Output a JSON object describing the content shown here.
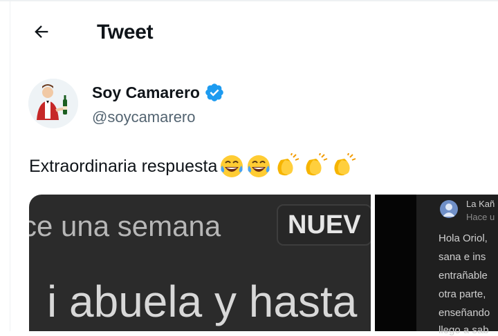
{
  "header": {
    "title": "Tweet",
    "back_icon": "arrow-left-icon"
  },
  "author": {
    "name": "Soy Camarero",
    "handle": "@soycamarero",
    "avatar_icon": "waiter-avatar",
    "verified_icon": "verified-badge-icon",
    "verified_color": "#1d9bf0"
  },
  "tweet": {
    "text": "Extraordinaria respuesta",
    "emojis": [
      "laughing-crying-emoji",
      "laughing-crying-emoji",
      "clapping-hands-emoji",
      "clapping-hands-emoji",
      "clapping-hands-emoji"
    ]
  },
  "media": {
    "left": {
      "line1": "ce una semana",
      "badge": "NUEV",
      "line2": "i abuela y hasta"
    },
    "right": {
      "commenter": "La Kañ",
      "time": "Hace u",
      "lines": [
        "Hola Oriol,",
        "sana e ins",
        "entrañable",
        "otra parte,",
        "enseñando",
        "llego a sab"
      ]
    }
  }
}
